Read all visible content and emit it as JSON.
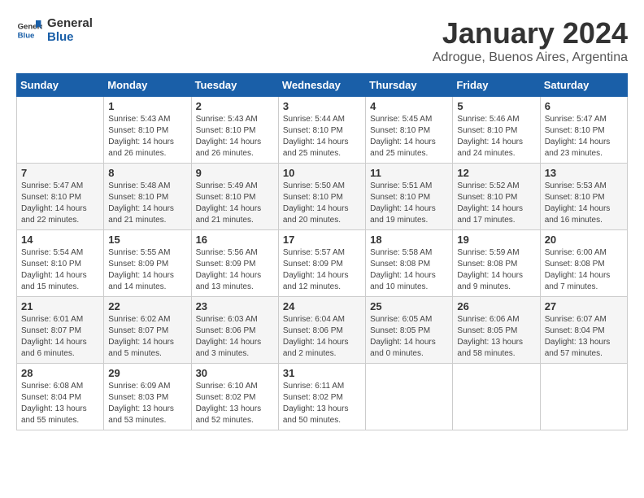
{
  "logo": {
    "line1": "General",
    "line2": "Blue"
  },
  "title": "January 2024",
  "location": "Adrogue, Buenos Aires, Argentina",
  "days_of_week": [
    "Sunday",
    "Monday",
    "Tuesday",
    "Wednesday",
    "Thursday",
    "Friday",
    "Saturday"
  ],
  "weeks": [
    [
      {
        "day": "",
        "info": ""
      },
      {
        "day": "1",
        "info": "Sunrise: 5:43 AM\nSunset: 8:10 PM\nDaylight: 14 hours\nand 26 minutes."
      },
      {
        "day": "2",
        "info": "Sunrise: 5:43 AM\nSunset: 8:10 PM\nDaylight: 14 hours\nand 26 minutes."
      },
      {
        "day": "3",
        "info": "Sunrise: 5:44 AM\nSunset: 8:10 PM\nDaylight: 14 hours\nand 25 minutes."
      },
      {
        "day": "4",
        "info": "Sunrise: 5:45 AM\nSunset: 8:10 PM\nDaylight: 14 hours\nand 25 minutes."
      },
      {
        "day": "5",
        "info": "Sunrise: 5:46 AM\nSunset: 8:10 PM\nDaylight: 14 hours\nand 24 minutes."
      },
      {
        "day": "6",
        "info": "Sunrise: 5:47 AM\nSunset: 8:10 PM\nDaylight: 14 hours\nand 23 minutes."
      }
    ],
    [
      {
        "day": "7",
        "info": "Sunrise: 5:47 AM\nSunset: 8:10 PM\nDaylight: 14 hours\nand 22 minutes."
      },
      {
        "day": "8",
        "info": "Sunrise: 5:48 AM\nSunset: 8:10 PM\nDaylight: 14 hours\nand 21 minutes."
      },
      {
        "day": "9",
        "info": "Sunrise: 5:49 AM\nSunset: 8:10 PM\nDaylight: 14 hours\nand 21 minutes."
      },
      {
        "day": "10",
        "info": "Sunrise: 5:50 AM\nSunset: 8:10 PM\nDaylight: 14 hours\nand 20 minutes."
      },
      {
        "day": "11",
        "info": "Sunrise: 5:51 AM\nSunset: 8:10 PM\nDaylight: 14 hours\nand 19 minutes."
      },
      {
        "day": "12",
        "info": "Sunrise: 5:52 AM\nSunset: 8:10 PM\nDaylight: 14 hours\nand 17 minutes."
      },
      {
        "day": "13",
        "info": "Sunrise: 5:53 AM\nSunset: 8:10 PM\nDaylight: 14 hours\nand 16 minutes."
      }
    ],
    [
      {
        "day": "14",
        "info": "Sunrise: 5:54 AM\nSunset: 8:10 PM\nDaylight: 14 hours\nand 15 minutes."
      },
      {
        "day": "15",
        "info": "Sunrise: 5:55 AM\nSunset: 8:09 PM\nDaylight: 14 hours\nand 14 minutes."
      },
      {
        "day": "16",
        "info": "Sunrise: 5:56 AM\nSunset: 8:09 PM\nDaylight: 14 hours\nand 13 minutes."
      },
      {
        "day": "17",
        "info": "Sunrise: 5:57 AM\nSunset: 8:09 PM\nDaylight: 14 hours\nand 12 minutes."
      },
      {
        "day": "18",
        "info": "Sunrise: 5:58 AM\nSunset: 8:08 PM\nDaylight: 14 hours\nand 10 minutes."
      },
      {
        "day": "19",
        "info": "Sunrise: 5:59 AM\nSunset: 8:08 PM\nDaylight: 14 hours\nand 9 minutes."
      },
      {
        "day": "20",
        "info": "Sunrise: 6:00 AM\nSunset: 8:08 PM\nDaylight: 14 hours\nand 7 minutes."
      }
    ],
    [
      {
        "day": "21",
        "info": "Sunrise: 6:01 AM\nSunset: 8:07 PM\nDaylight: 14 hours\nand 6 minutes."
      },
      {
        "day": "22",
        "info": "Sunrise: 6:02 AM\nSunset: 8:07 PM\nDaylight: 14 hours\nand 5 minutes."
      },
      {
        "day": "23",
        "info": "Sunrise: 6:03 AM\nSunset: 8:06 PM\nDaylight: 14 hours\nand 3 minutes."
      },
      {
        "day": "24",
        "info": "Sunrise: 6:04 AM\nSunset: 8:06 PM\nDaylight: 14 hours\nand 2 minutes."
      },
      {
        "day": "25",
        "info": "Sunrise: 6:05 AM\nSunset: 8:05 PM\nDaylight: 14 hours\nand 0 minutes."
      },
      {
        "day": "26",
        "info": "Sunrise: 6:06 AM\nSunset: 8:05 PM\nDaylight: 13 hours\nand 58 minutes."
      },
      {
        "day": "27",
        "info": "Sunrise: 6:07 AM\nSunset: 8:04 PM\nDaylight: 13 hours\nand 57 minutes."
      }
    ],
    [
      {
        "day": "28",
        "info": "Sunrise: 6:08 AM\nSunset: 8:04 PM\nDaylight: 13 hours\nand 55 minutes."
      },
      {
        "day": "29",
        "info": "Sunrise: 6:09 AM\nSunset: 8:03 PM\nDaylight: 13 hours\nand 53 minutes."
      },
      {
        "day": "30",
        "info": "Sunrise: 6:10 AM\nSunset: 8:02 PM\nDaylight: 13 hours\nand 52 minutes."
      },
      {
        "day": "31",
        "info": "Sunrise: 6:11 AM\nSunset: 8:02 PM\nDaylight: 13 hours\nand 50 minutes."
      },
      {
        "day": "",
        "info": ""
      },
      {
        "day": "",
        "info": ""
      },
      {
        "day": "",
        "info": ""
      }
    ]
  ]
}
